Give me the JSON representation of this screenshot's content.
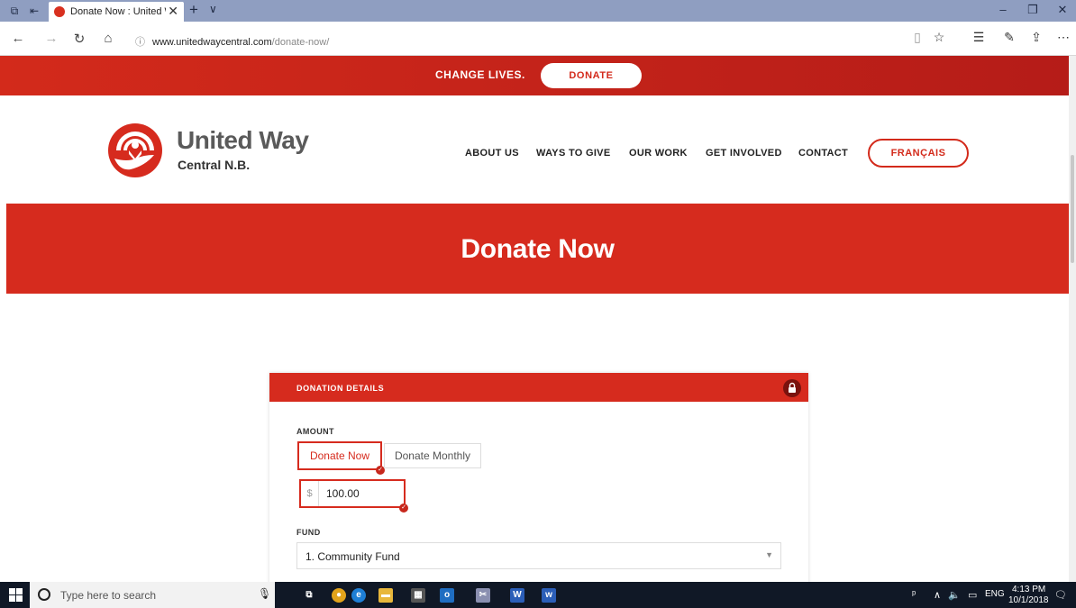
{
  "browser": {
    "tab_title": "Donate Now : United W",
    "tab_close": "✕",
    "new_tab": "+",
    "tab_list": "∨",
    "url_domain": "www.unitedwaycentral.com",
    "url_path": "/donate-now/",
    "window_controls": {
      "minimize": "–",
      "restore": "❐",
      "close": "✕"
    }
  },
  "topband": {
    "tagline": "CHANGE LIVES.",
    "donate_label": "DONATE"
  },
  "header": {
    "logo_name": "United Way",
    "logo_sub": "Central N.B.",
    "nav": [
      "ABOUT US",
      "WAYS TO GIVE",
      "OUR WORK",
      "GET INVOLVED",
      "CONTACT"
    ],
    "lang_button": "FRANÇAIS"
  },
  "hero": {
    "title": "Donate Now"
  },
  "donation": {
    "section_title": "DONATION DETAILS",
    "amount_label": "AMOUNT",
    "option_now": "Donate Now",
    "option_monthly": "Donate Monthly",
    "currency_symbol": "$",
    "amount_value": "100.00",
    "fund_label": "FUND",
    "fund_selected": "1. Community Fund"
  },
  "taskbar": {
    "search_placeholder": "Type here to search",
    "lang": "ENG",
    "time": "4:13 PM",
    "date": "10/1/2018"
  },
  "colors": {
    "brand_red": "#d62b1e",
    "dark_red": "#b51c18",
    "taskbar": "#101826",
    "tabbar": "#8f9ec1"
  }
}
